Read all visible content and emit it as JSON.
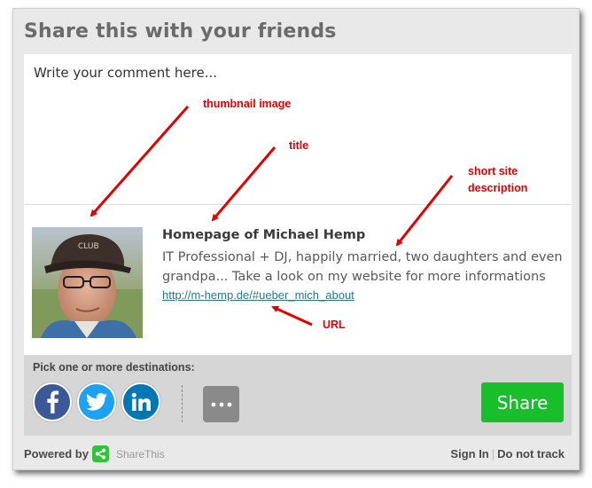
{
  "dialog": {
    "title": "Share this with your friends",
    "comment_placeholder": "Write your comment here..."
  },
  "preview": {
    "title": "Homepage of Michael Hemp",
    "description": "IT Professional + DJ, happily married, two daughters and even grandpa... Take a look on my website for more informations",
    "url": "http://m-hemp.de/#ueber_mich_about"
  },
  "destinations": {
    "label": "Pick one or more destinations:",
    "services": [
      {
        "name": "facebook",
        "icon": "facebook-icon",
        "color": "#3b5998"
      },
      {
        "name": "twitter",
        "icon": "twitter-icon",
        "color": "#1da1f2"
      },
      {
        "name": "linkedin",
        "icon": "linkedin-icon",
        "color": "#0077b5"
      }
    ],
    "more_icon": "more-dots-icon",
    "share_label": "Share",
    "share_color": "#19bf2a"
  },
  "footer": {
    "powered_by": "Powered by",
    "brand": "ShareThis",
    "sign_in": "Sign In",
    "separator": "|",
    "do_not_track": "Do not track"
  },
  "annotations": {
    "thumbnail": "thumbnail image",
    "title": "title",
    "short_desc_line1": "short site",
    "short_desc_line2": "description",
    "url": "URL",
    "color": "#e30000"
  }
}
